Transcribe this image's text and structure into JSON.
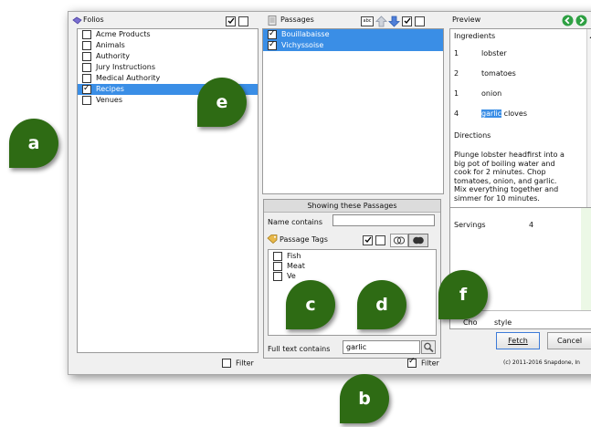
{
  "folios": {
    "title": "Folios",
    "filter_label": "Filter",
    "items": [
      {
        "label": "Acme Products",
        "checked": false,
        "selected": false
      },
      {
        "label": "Animals",
        "checked": false,
        "selected": false
      },
      {
        "label": "Authority",
        "checked": false,
        "selected": false
      },
      {
        "label": "Jury Instructions",
        "checked": false,
        "selected": false
      },
      {
        "label": "Medical Authority",
        "checked": false,
        "selected": false
      },
      {
        "label": "Recipes",
        "checked": true,
        "selected": true
      },
      {
        "label": "Venues",
        "checked": false,
        "selected": false
      }
    ]
  },
  "passages": {
    "title": "Passages",
    "abc_label": "abc",
    "filter_label": "Filter",
    "filter_checked": true,
    "items": [
      {
        "label": "Bouillabaisse",
        "checked": true
      },
      {
        "label": "Vichyssoise",
        "checked": true
      }
    ]
  },
  "showing": {
    "title": "Showing these Passages",
    "name_contains_label": "Name contains",
    "name_contains_value": "",
    "tags_label": "Passage Tags",
    "tags": [
      "Fish",
      "Meat",
      "Ve"
    ],
    "full_text_label": "Full text contains",
    "full_text_value": "garlic"
  },
  "preview": {
    "title": "Preview",
    "ingredients_heading": "Ingredients",
    "ingredients": [
      {
        "qty": "1",
        "item": "lobster"
      },
      {
        "qty": "2",
        "item": "tomatoes"
      },
      {
        "qty": "1",
        "item": "onion"
      },
      {
        "qty": "4",
        "item_highlight": "garlic",
        "item_rest": " cloves"
      }
    ],
    "directions_heading": "Directions",
    "directions_lines": [
      "Plunge lobster headfirst into a",
      "big pot of boiling water and",
      "cook for 2 minutes.  Chop",
      "tomatoes, onion, and garlic.",
      "Mix everything together and",
      "simmer for 10 minutes."
    ],
    "servings_label": "Servings",
    "servings_value": "4",
    "choose_style_partial": "Cho",
    "choose_style_rest": "style"
  },
  "buttons": {
    "fetch": "Fetch",
    "cancel": "Cancel"
  },
  "copyright": "(c) 2011-2016 Snapdone, In",
  "callouts": [
    "a",
    "b",
    "c",
    "d",
    "e",
    "f"
  ],
  "colors": {
    "selection": "#3a8ee6",
    "callout": "#2e6b14",
    "nav_green": "#2ea043"
  }
}
